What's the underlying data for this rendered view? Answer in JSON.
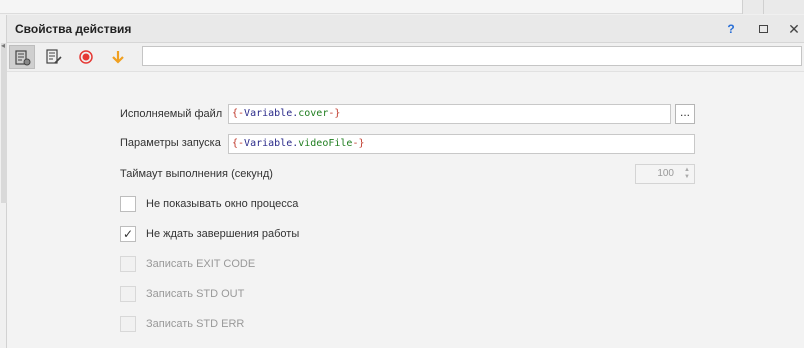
{
  "window": {
    "title": "Свойства действия",
    "help_label": "?",
    "close_label": "✕"
  },
  "toolbar": {
    "tools": [
      "properties-icon",
      "edit-icon",
      "record-icon",
      "arrow-down-icon"
    ],
    "search_value": ""
  },
  "form": {
    "executable_label": "Исполняемый файл",
    "executable_value": {
      "open": "{-",
      "var": "Variable",
      "dot": ".",
      "prop": "cover",
      "close": "-}"
    },
    "browse_label": "...",
    "params_label": "Параметры запуска",
    "params_value": {
      "open": "{-",
      "var": "Variable",
      "dot": ".",
      "prop": "videoFile",
      "close": "-}"
    },
    "timeout_label": "Таймаут выполнения (секунд)",
    "timeout_value": "100"
  },
  "options": [
    {
      "label": "Не показывать окно процесса",
      "checked": false,
      "enabled": true
    },
    {
      "label": "Не ждать завершения работы",
      "checked": true,
      "enabled": true
    },
    {
      "label": "Записать EXIT CODE",
      "checked": false,
      "enabled": false
    },
    {
      "label": "Записать STD OUT",
      "checked": false,
      "enabled": false
    },
    {
      "label": "Записать STD ERR",
      "checked": false,
      "enabled": false
    }
  ],
  "colors": {
    "accent_blue": "#2a6fd6",
    "record_red": "#e53935",
    "arrow_orange": "#f0a020"
  }
}
